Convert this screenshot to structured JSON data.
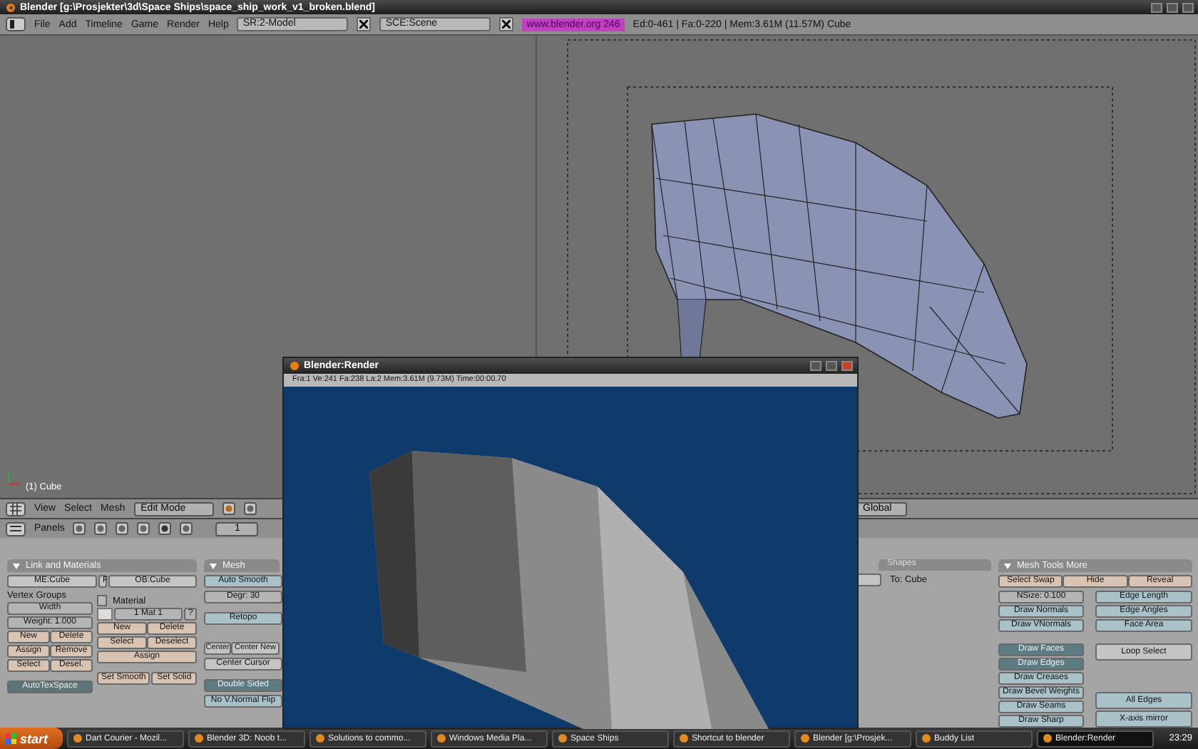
{
  "window": {
    "title": "Blender [g:\\Prosjekter\\3d\\Space Ships\\space_ship_work_v1_broken.blend]"
  },
  "menu": [
    "File",
    "Add",
    "Timeline",
    "Game",
    "Render",
    "Help"
  ],
  "screen_field": "SR:2-Model",
  "scene_field": "SCE:Scene",
  "link": "www.blender.org 246",
  "stats": "Ed:0-461 | Fa:0-220 | Mem:3.61M (11.57M) Cube",
  "viewport": {
    "object_label": "(1) Cube"
  },
  "view_header": {
    "menu": [
      "View",
      "Select",
      "Mesh"
    ],
    "mode": "Edit Mode",
    "orientation": "Global"
  },
  "buttons_header": {
    "label": "Panels",
    "frame": "1"
  },
  "link_materials": {
    "title": "Link and Materials",
    "mesh_field": "ME:Cube",
    "f_label": "F",
    "object_field": "OB:Cube",
    "vertex_groups_label": "Vertex Groups",
    "group_name": "Width",
    "weight": "Weight: 1.000",
    "vg_buttons": [
      [
        "New",
        "Delete"
      ],
      [
        "Assign",
        "Remove"
      ],
      [
        "Select",
        "Desel."
      ]
    ],
    "autotex": "AutoTexSpace",
    "material_label": "Material",
    "material_index": "1 Mat 1",
    "material_q": "?",
    "mat_buttons": [
      [
        "New",
        "Delete"
      ],
      [
        "Select",
        "Deselect"
      ],
      [
        "Assign"
      ]
    ],
    "smooth_buttons": [
      "Set Smooth",
      "Set Solid"
    ]
  },
  "mesh": {
    "title": "Mesh",
    "auto_smooth": {
      "label": "Auto Smooth",
      "on": false
    },
    "degr": "Degr: 30",
    "retopo": {
      "label": "Retopo",
      "on": false
    },
    "center_buttons": [
      "Center",
      "Center New"
    ],
    "center_cursor": "Center Cursor",
    "toggles": [
      {
        "label": "Double Sided",
        "on": true
      },
      {
        "label": "No V.Normal Flip",
        "on": false
      }
    ]
  },
  "shapes": {
    "tab": "Shapes",
    "to_label": "To: Cube"
  },
  "mesh_tools_more": {
    "title": "Mesh Tools More",
    "top_buttons": [
      "Select Swap",
      "Hide",
      "Reveal"
    ],
    "nsize": "NSize: 0.100",
    "normal_toggles": [
      {
        "label": "Draw Normals",
        "on": false
      },
      {
        "label": "Draw VNormals",
        "on": false
      }
    ],
    "measure_toggles": [
      {
        "label": "Edge Length",
        "on": false
      },
      {
        "label": "Edge Angles",
        "on": false
      },
      {
        "label": "Face Area",
        "on": false
      }
    ],
    "draw_toggles": [
      {
        "label": "Draw Faces",
        "on": true
      },
      {
        "label": "Draw Edges",
        "on": true
      },
      {
        "label": "Draw Creases",
        "on": false
      },
      {
        "label": "Draw Bevel Weights",
        "on": false
      },
      {
        "label": "Draw Seams",
        "on": false
      },
      {
        "label": "Draw Sharp",
        "on": false
      }
    ],
    "loop_select": "Loop Select",
    "edge_toggles": [
      {
        "label": "All Edges",
        "on": false
      },
      {
        "label": "X-axis mirror",
        "on": false
      }
    ]
  },
  "render_window": {
    "title": "Blender:Render",
    "info": "Fra:1 Ve:241 Fa:238 La:2 Mem:3.61M (9.73M) Time:00:00.70"
  },
  "taskbar": {
    "start": "start",
    "items": [
      {
        "label": "Dart Courier - Mozil...",
        "selected": false
      },
      {
        "label": "Blender 3D: Noob t...",
        "selected": false
      },
      {
        "label": "Solutions to commo...",
        "selected": false
      },
      {
        "label": "Windows Media Pla...",
        "selected": false
      },
      {
        "label": "Space Ships",
        "selected": false
      },
      {
        "label": "Shortcut to blender",
        "selected": false
      },
      {
        "label": "Blender [g:\\Prosjek...",
        "selected": false
      },
      {
        "label": "Buddy List",
        "selected": false
      },
      {
        "label": "Blender:Render",
        "selected": true
      }
    ],
    "clock": "23:29"
  }
}
